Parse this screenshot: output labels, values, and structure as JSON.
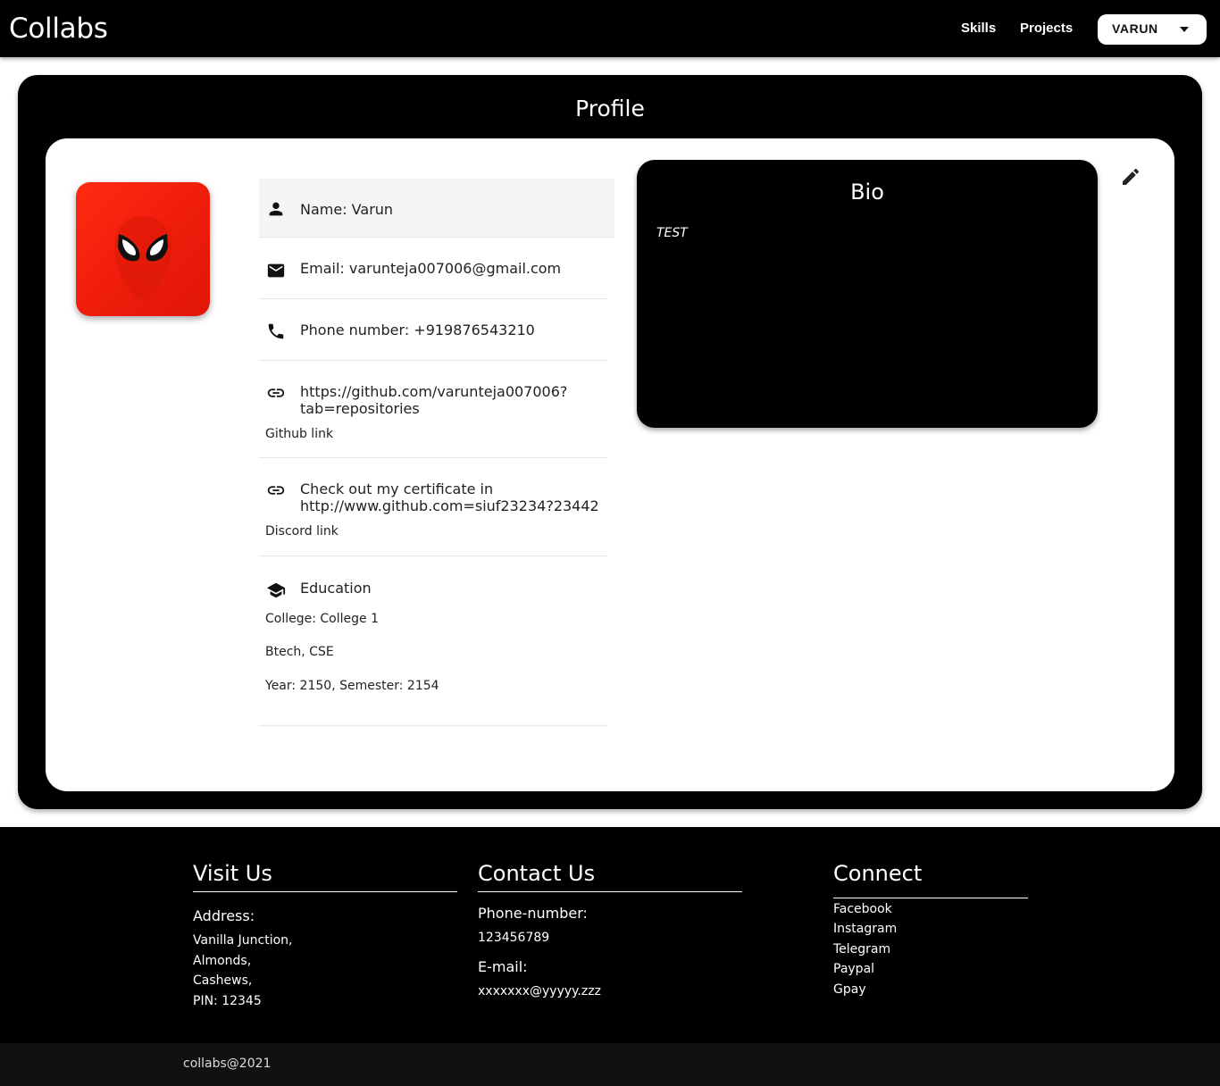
{
  "header": {
    "brand": "Collabs",
    "nav": {
      "skills": "Skills",
      "projects": "Projects"
    },
    "user_menu": {
      "label": "VARUN",
      "icon": "arrow-drop-down-icon"
    }
  },
  "profile": {
    "title": "Profile",
    "avatar": {
      "icon": "spiderman-mask-icon",
      "color": "#ff2a12"
    },
    "details": {
      "name": {
        "icon": "person-icon",
        "text": "Name: Varun"
      },
      "email": {
        "icon": "mail-icon",
        "text": "Email: varunteja007006@gmail.com"
      },
      "phone": {
        "icon": "phone-icon",
        "text": "Phone number: +919876543210"
      },
      "github": {
        "icon": "link-icon",
        "line1": "https://github.com/varunteja007006?",
        "line2": "tab=repositories",
        "caption": "Github link"
      },
      "discord": {
        "icon": "link-icon",
        "line1": "Check out my certificate in",
        "line2": "http://www.github.com=siuf23234?23442",
        "caption": "Discord link"
      },
      "education": {
        "icon": "school-icon",
        "heading": "Education",
        "college": "College: College 1",
        "degree": "Btech, CSE",
        "year": "Year: 2150, Semester: 2154"
      }
    },
    "bio": {
      "title": "Bio",
      "text": "TEST"
    },
    "edit_icon": "edit-pencil-icon"
  },
  "footer": {
    "visit": {
      "heading": "Visit Us",
      "address_label": "Address:",
      "address_lines": [
        "Vanilla Junction,",
        "Almonds,",
        "Cashews,",
        "PIN: 12345"
      ]
    },
    "contact": {
      "heading": "Contact Us",
      "phone_label": "Phone-number:",
      "phone": "123456789",
      "email_label": "E-mail:",
      "email": "xxxxxxx@yyyyy.zzz"
    },
    "connect": {
      "heading": "Connect",
      "links": [
        "Facebook",
        "Instagram",
        "Telegram",
        "Paypal",
        "Gpay"
      ]
    },
    "copyright": "collabs@2021"
  }
}
